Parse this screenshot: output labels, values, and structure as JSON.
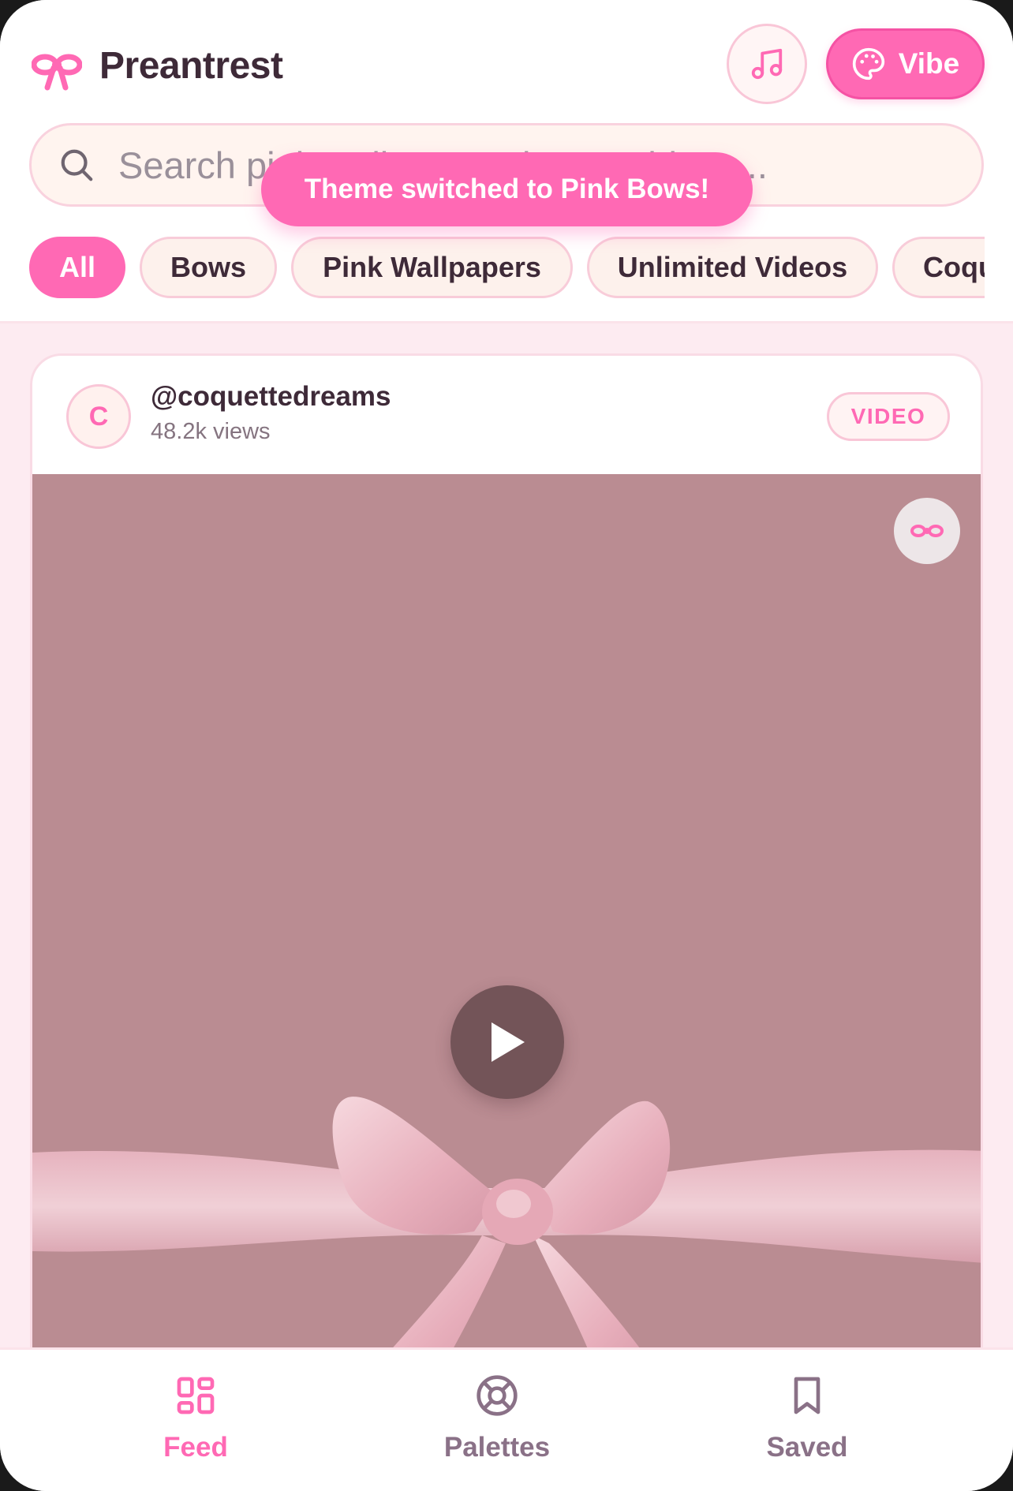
{
  "app": {
    "title": "Preantrest",
    "accent_color": "#ff69b4"
  },
  "header": {
    "music_button_icon": "music-note-icon",
    "vibe_button": {
      "label": "Vibe",
      "icon": "palette-icon"
    }
  },
  "search": {
    "placeholder": "Search pink wallpapers, bows, videos..."
  },
  "toast": {
    "message": "Theme switched to Pink Bows!"
  },
  "categories": [
    {
      "label": "All",
      "active": true
    },
    {
      "label": "Bows",
      "active": false
    },
    {
      "label": "Pink Wallpapers",
      "active": false
    },
    {
      "label": "Unlimited Videos",
      "active": false
    },
    {
      "label": "Coqu",
      "active": false
    }
  ],
  "post": {
    "avatar_initial": "C",
    "username": "@coquettedreams",
    "views": "48.2k views",
    "badge": "VIDEO",
    "media_icon": "bow-icon",
    "play_icon": "play-icon"
  },
  "bottom_nav": [
    {
      "label": "Feed",
      "icon": "grid-icon",
      "active": true
    },
    {
      "label": "Palettes",
      "icon": "lifebuoy-icon",
      "active": false
    },
    {
      "label": "Saved",
      "icon": "bookmark-icon",
      "active": false
    }
  ]
}
